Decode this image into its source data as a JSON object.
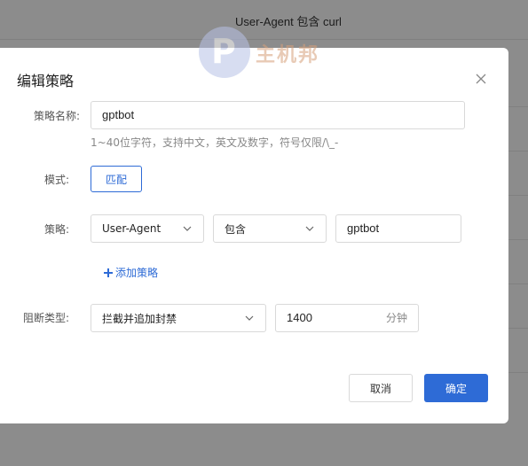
{
  "background": {
    "header_text": "User-Agent 包含 curl"
  },
  "watermark": {
    "text": "主机邦"
  },
  "dialog": {
    "title": "编辑策略",
    "close_icon": "close-icon",
    "name_label": "策略名称:",
    "name_value": "gptbot",
    "name_hint": "1~40位字符，支持中文，英文及数字，符号仅限/\\_-",
    "mode_label": "模式:",
    "mode_button": "匹配",
    "policy_label": "策略:",
    "policy_field": "User-Agent",
    "policy_operator": "包含",
    "policy_value": "gptbot",
    "add_policy": "添加策略",
    "block_label": "阻断类型:",
    "block_type": "拦截并追加封禁",
    "block_duration": "1400",
    "block_unit": "分钟",
    "cancel": "取消",
    "confirm": "确定"
  },
  "colors": {
    "accent": "#2e6bd6",
    "overlay": "rgba(0,0,0,0.45)"
  }
}
